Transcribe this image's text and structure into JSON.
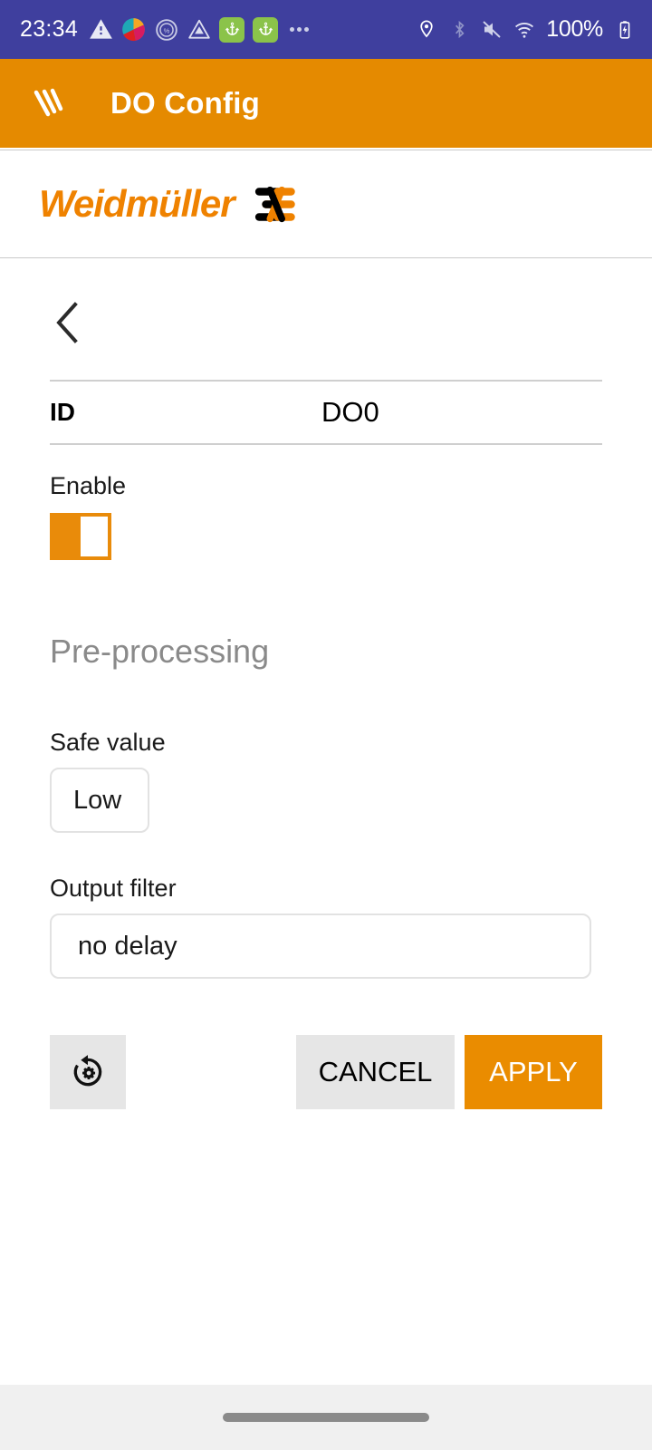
{
  "status_bar": {
    "time": "23:34",
    "battery_percent": "100%",
    "left_icons": [
      "warning-triangle-icon",
      "app-color-circle-icon",
      "percent-circle-icon",
      "triangle-outline-icon",
      "anchor-badge-icon",
      "anchor-badge-icon",
      "more-dots-icon"
    ],
    "right_icons": [
      "location-pin-icon",
      "bluetooth-icon",
      "volume-muted-icon",
      "wifi-icon",
      "battery-charging-icon"
    ],
    "background_color": "#3f3f9e"
  },
  "app_bar": {
    "menu_icon": "slanted-lines-menu-icon",
    "title": "DO Config",
    "background_color": "#e58a00"
  },
  "brand": {
    "name": "Weidmüller",
    "mark": "weidmueller-logo-mark",
    "text_color": "#ef8200"
  },
  "navigation": {
    "back_icon": "chevron-left-icon"
  },
  "id_row": {
    "label": "ID",
    "value": "DO0"
  },
  "enable": {
    "label": "Enable",
    "state": "on"
  },
  "section": {
    "title": "Pre-processing"
  },
  "safe_value": {
    "label": "Safe value",
    "value": "Low"
  },
  "output_filter": {
    "label": "Output filter",
    "value": "no delay"
  },
  "actions": {
    "reset_icon": "settings-backup-restore-icon",
    "cancel_label": "CANCEL",
    "apply_label": "APPLY",
    "apply_color": "#ea8c00"
  },
  "nav_bar": {
    "handle": "gesture-pill-handle"
  }
}
